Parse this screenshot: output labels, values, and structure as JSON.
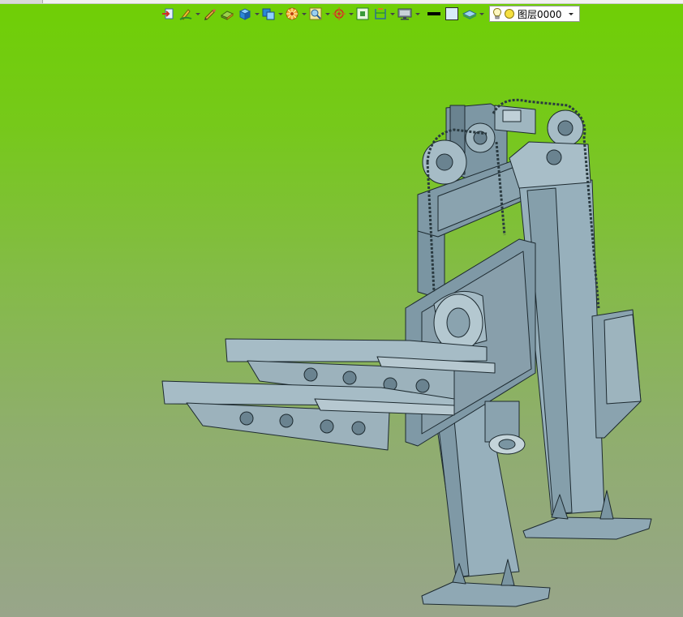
{
  "toolbar": {
    "tools": [
      {
        "icon": "import-icon",
        "dropdown": false
      },
      {
        "icon": "pen-sketch-icon",
        "dropdown": true
      },
      {
        "icon": "pencil-icon",
        "dropdown": false
      },
      {
        "icon": "eraser-block-icon",
        "dropdown": false
      },
      {
        "icon": "solid-cube-icon",
        "dropdown": true
      },
      {
        "icon": "copy-view-icon",
        "dropdown": true
      },
      {
        "icon": "render-wheel-icon",
        "dropdown": true
      },
      {
        "icon": "zoom-view-icon",
        "dropdown": true
      },
      {
        "icon": "locate-target-icon",
        "dropdown": true
      },
      {
        "icon": "fit-view-icon",
        "dropdown": false
      },
      {
        "icon": "section-icon",
        "dropdown": true
      },
      {
        "icon": "monitor-display-icon",
        "dropdown": true
      },
      {
        "icon": "line-weight-icon",
        "dropdown": false
      },
      {
        "icon": "color-box-icon",
        "dropdown": false
      },
      {
        "icon": "layers-icon",
        "dropdown": true
      }
    ],
    "layer": {
      "name": "图层0000",
      "icons": [
        "lightbulb-icon",
        "sun-icon"
      ]
    }
  },
  "viewport": {
    "background_top": "#6fcf05",
    "background_bottom": "#98a58a",
    "model_color": "#8fa8b4",
    "model_edge_color": "#1d2a30"
  }
}
